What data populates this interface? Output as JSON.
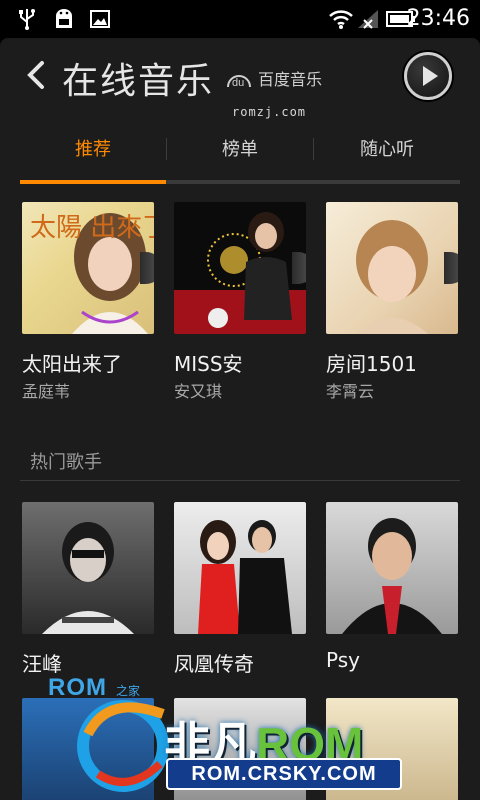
{
  "status_bar": {
    "time": "23:46",
    "icons": [
      "usb-icon",
      "android-debug-icon",
      "image-icon",
      "wifi-icon",
      "signal-icon",
      "battery-icon"
    ]
  },
  "header": {
    "title": "在线音乐",
    "brand_logo": "du",
    "brand_name": "百度音乐",
    "watermark": "romzj.com"
  },
  "tabs": [
    {
      "label": "推荐",
      "active": true
    },
    {
      "label": "榜单",
      "active": false
    },
    {
      "label": "随心听",
      "active": false
    }
  ],
  "albums": [
    {
      "title": "太阳出来了",
      "artist": "孟庭苇",
      "cover_text": "太陽 出來了"
    },
    {
      "title": "MISS安",
      "artist": "安又琪"
    },
    {
      "title": "房间1501",
      "artist": "李霄云"
    }
  ],
  "hot_singers": {
    "section_title": "热门歌手",
    "items": [
      {
        "name": "汪峰"
      },
      {
        "name": "凤凰传奇"
      },
      {
        "name": "Psy"
      }
    ]
  },
  "watermark": {
    "rom_small": "ROM",
    "rom_small_tail": "之家",
    "brand_cn": "非凡",
    "brand_rom": "ROM",
    "url": "ROM.CRSKY.COM"
  },
  "colors": {
    "accent": "#ff8a00",
    "background": "#1c1c1d"
  }
}
